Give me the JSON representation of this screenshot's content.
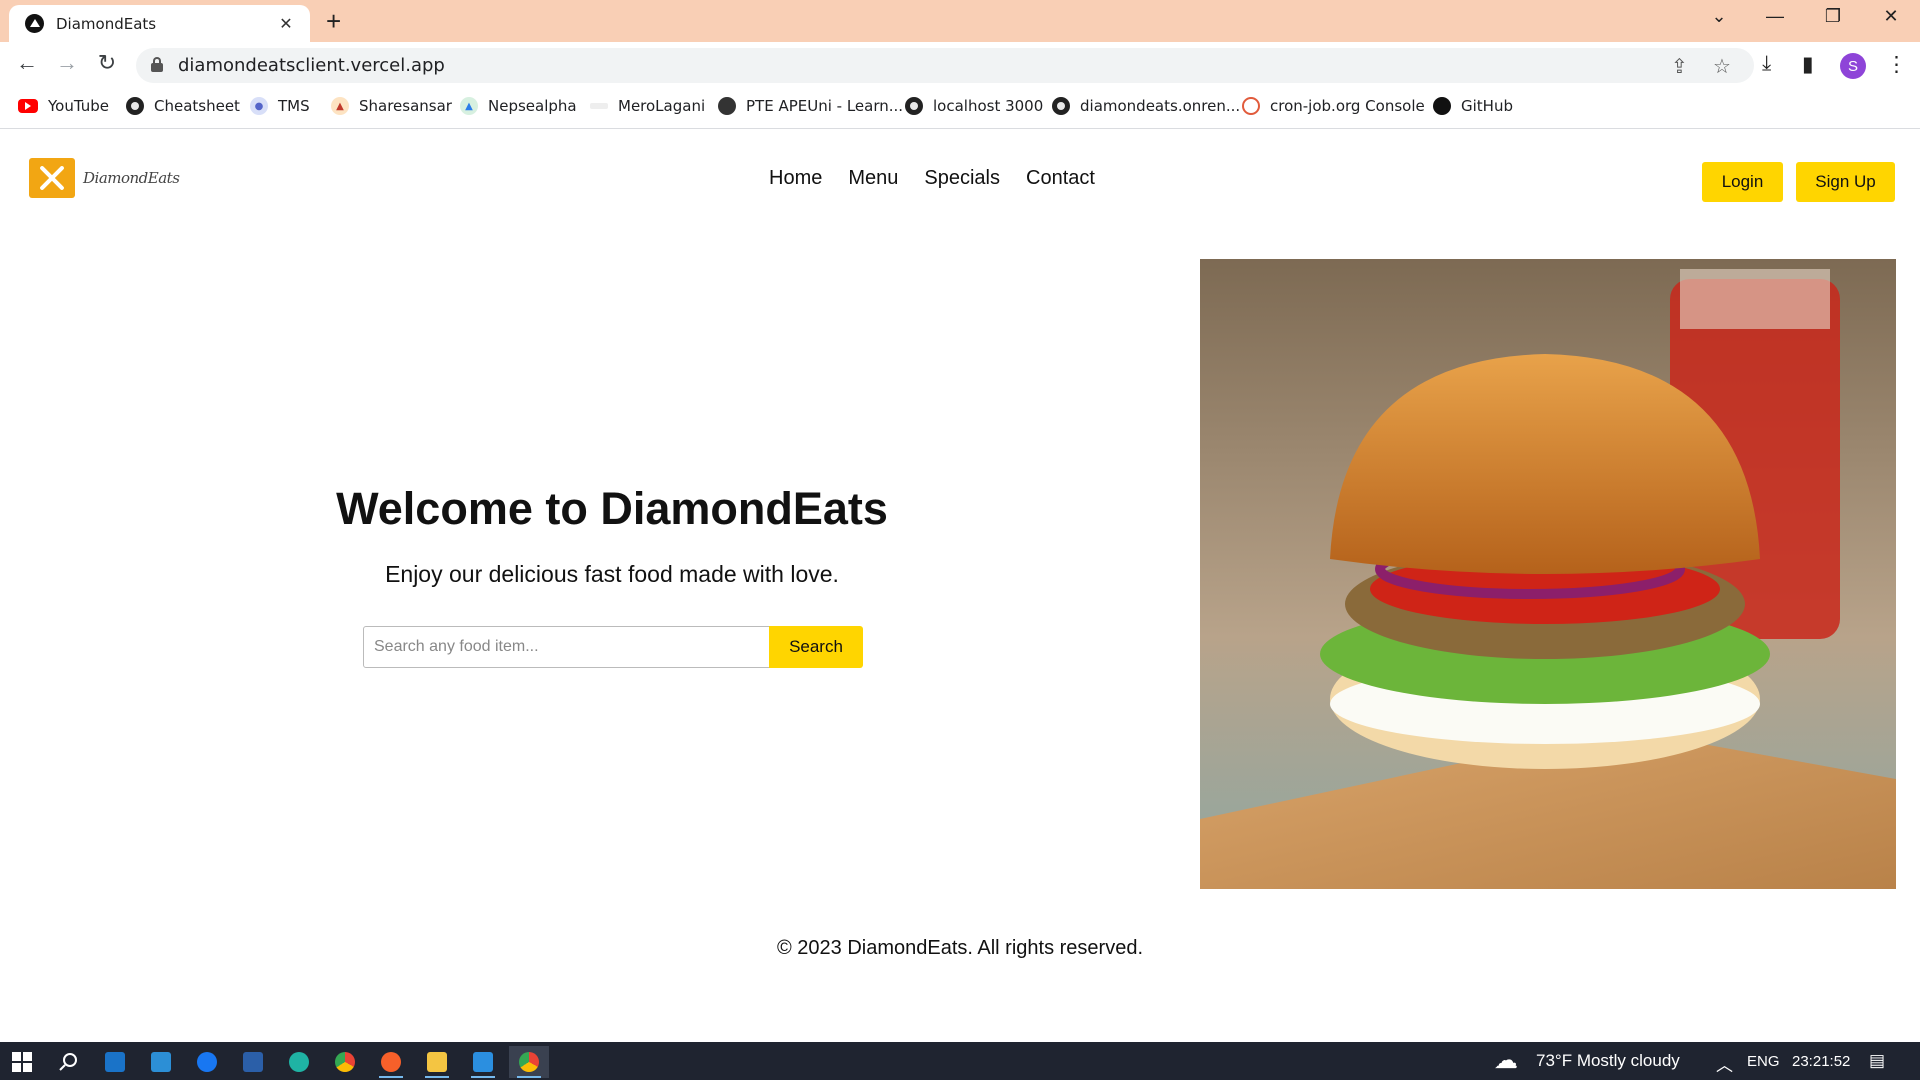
{
  "browser": {
    "tab_title": "DiamondEats",
    "url": "diamondeatsclient.vercel.app",
    "profile_initial": "S",
    "bookmarks": [
      {
        "label": "YouTube",
        "icon": "youtube-icon"
      },
      {
        "label": "Cheatsheet",
        "icon": "globe-icon"
      },
      {
        "label": "TMS",
        "icon": "tms-icon"
      },
      {
        "label": "Sharesansar",
        "icon": "sharesansar-icon"
      },
      {
        "label": "Nepsealpha",
        "icon": "nepsealpha-icon"
      },
      {
        "label": "MeroLagani",
        "icon": "merolagani-icon"
      },
      {
        "label": "PTE APEUni - Learn...",
        "icon": "pte-icon"
      },
      {
        "label": "localhost 3000",
        "icon": "globe-icon"
      },
      {
        "label": "diamondeats.onren...",
        "icon": "globe-icon"
      },
      {
        "label": "cron-job.org Console",
        "icon": "cron-icon"
      },
      {
        "label": "GitHub",
        "icon": "github-icon"
      }
    ]
  },
  "site": {
    "logo_text": "DiamondEats",
    "nav": [
      "Home",
      "Menu",
      "Specials",
      "Contact"
    ],
    "login_label": "Login",
    "signup_label": "Sign Up",
    "hero_title": "Welcome to DiamondEats",
    "hero_subtitle": "Enjoy our delicious fast food made with love.",
    "search_placeholder": "Search any food item...",
    "search_button": "Search",
    "footer": "© 2023 DiamondEats. All rights reserved.",
    "accent_color": "#ffd500"
  },
  "taskbar": {
    "weather": "73°F  Mostly cloudy",
    "language": "ENG",
    "time": "23:21:52"
  }
}
